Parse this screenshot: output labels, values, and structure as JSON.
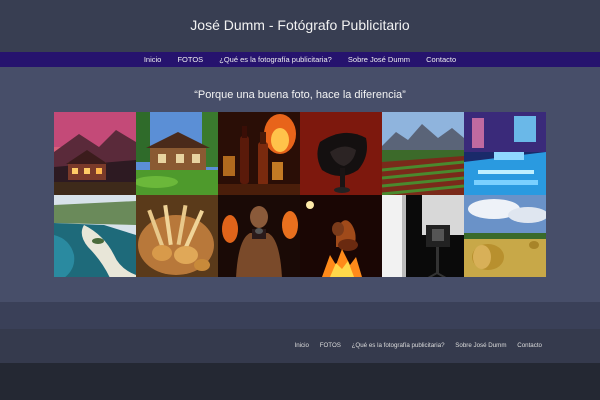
{
  "site": {
    "title": "José Dumm - Fotógrafo Publicitario"
  },
  "nav": {
    "items": [
      {
        "label": "Inicio"
      },
      {
        "label": "FOTOS"
      },
      {
        "label": "¿Qué es la fotografía publicitaria?"
      },
      {
        "label": "Sobre José Dumm"
      },
      {
        "label": "Contacto"
      }
    ]
  },
  "main": {
    "quote": "“Porque una buena foto, hace la diferencia”"
  },
  "gallery": {
    "tiles": [
      {
        "subject": "mountain-lodge-dusk"
      },
      {
        "subject": "wooden-house-garden"
      },
      {
        "subject": "liquor-bottles-fire"
      },
      {
        "subject": "leather-saddle"
      },
      {
        "subject": "vineyard-mountains"
      },
      {
        "subject": "pool-lounge-lights"
      },
      {
        "subject": "lake-coast-aerial"
      },
      {
        "subject": "bread-basket"
      },
      {
        "subject": "shirtless-man-portrait"
      },
      {
        "subject": "campfire-guitar"
      },
      {
        "subject": "studio-camera-flash"
      },
      {
        "subject": "hay-bale-field"
      }
    ]
  },
  "footer": {
    "nav": [
      {
        "label": "Inicio"
      },
      {
        "label": "FOTOS"
      },
      {
        "label": "¿Qué es la fotografía publicitaria?"
      },
      {
        "label": "Sobre José Dumm"
      },
      {
        "label": "Contacto"
      }
    ]
  }
}
